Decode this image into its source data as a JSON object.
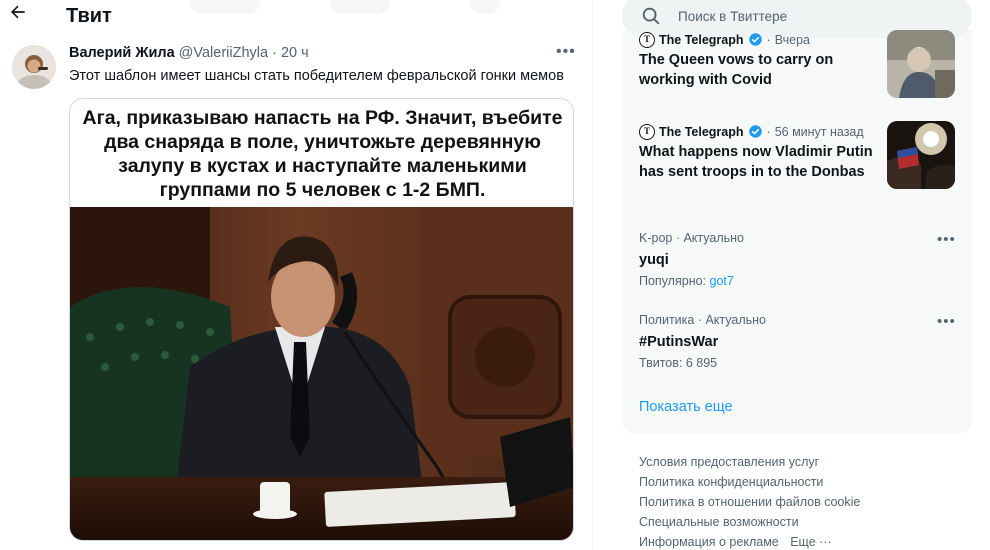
{
  "header": {
    "title": "Твит"
  },
  "tweet": {
    "author_name": "Валерий Жила",
    "author_handle": "@ValeriiZhyla",
    "dot": "·",
    "time": "20 ч",
    "more": "•••",
    "text": "Этот шаблон имеет шансы стать победителем февральской гонки мемов",
    "media_caption": "Ага, приказываю напасть на РФ. Значит, въебите два снаряда в поле, уничтожьте деревянную залупу в кустах и наступайте маленькими группами по 5 человек с 1-2 БМП."
  },
  "search": {
    "placeholder": "Поиск в Твиттере"
  },
  "news": [
    {
      "source": "The Telegraph",
      "time": "Вчера",
      "title": "The Queen vows to carry on working with Covid"
    },
    {
      "source": "The Telegraph",
      "time": "56 минут назад",
      "title": "What happens now Vladimir Putin has sent troops in to the Donbas"
    }
  ],
  "trends": [
    {
      "meta": "K-pop · Актуально",
      "name": "yuqi",
      "sub_label": "Популярно:",
      "sub_link": "got7"
    },
    {
      "meta": "Политика · Актуально",
      "name": "#PutinsWar",
      "sub_label": "Твитов: 6 895"
    }
  ],
  "show_more": "Показать еще",
  "footer": {
    "links": [
      "Условия предоставления услуг",
      "Политика конфиденциальности",
      "Политика в отношении файлов cookie",
      "Специальные возможности",
      "Информация о рекламе"
    ],
    "more": "Еще"
  },
  "colors": {
    "accent": "#1d9bf0",
    "text": "#0f1419",
    "secondary_text": "#536471",
    "card_bg": "#f7f9f9"
  },
  "icons": [
    "back-arrow-icon",
    "search-icon",
    "verified-badge-icon",
    "more-dots-icon",
    "chevron-down-icon"
  ]
}
